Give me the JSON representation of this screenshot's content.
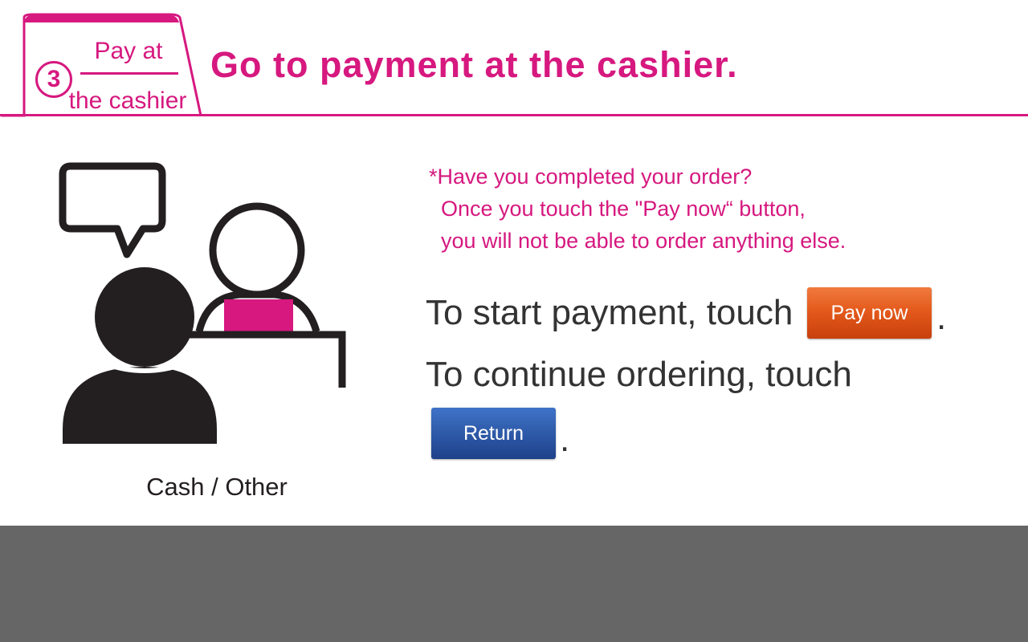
{
  "header": {
    "step_number": "3",
    "step_label_top": "Pay at",
    "step_label_bottom": "the cashier",
    "title": "Go to payment at the cashier."
  },
  "illustration": {
    "caption": "Cash / Other"
  },
  "notice": {
    "line1": "*Have you completed your order?",
    "line2": "Once you touch the \"Pay now“ button,",
    "line3": "you will not be able to order anything else."
  },
  "instructions": {
    "pay_text": "To start payment, touch",
    "return_text": "To continue ordering, touch",
    "period": "."
  },
  "buttons": {
    "pay_now": "Pay now",
    "return": "Return"
  },
  "colors": {
    "accent": "#d6187f",
    "pay_button": "#e45a1c",
    "return_button": "#2e5aa8",
    "bottom_bar": "#666666"
  }
}
